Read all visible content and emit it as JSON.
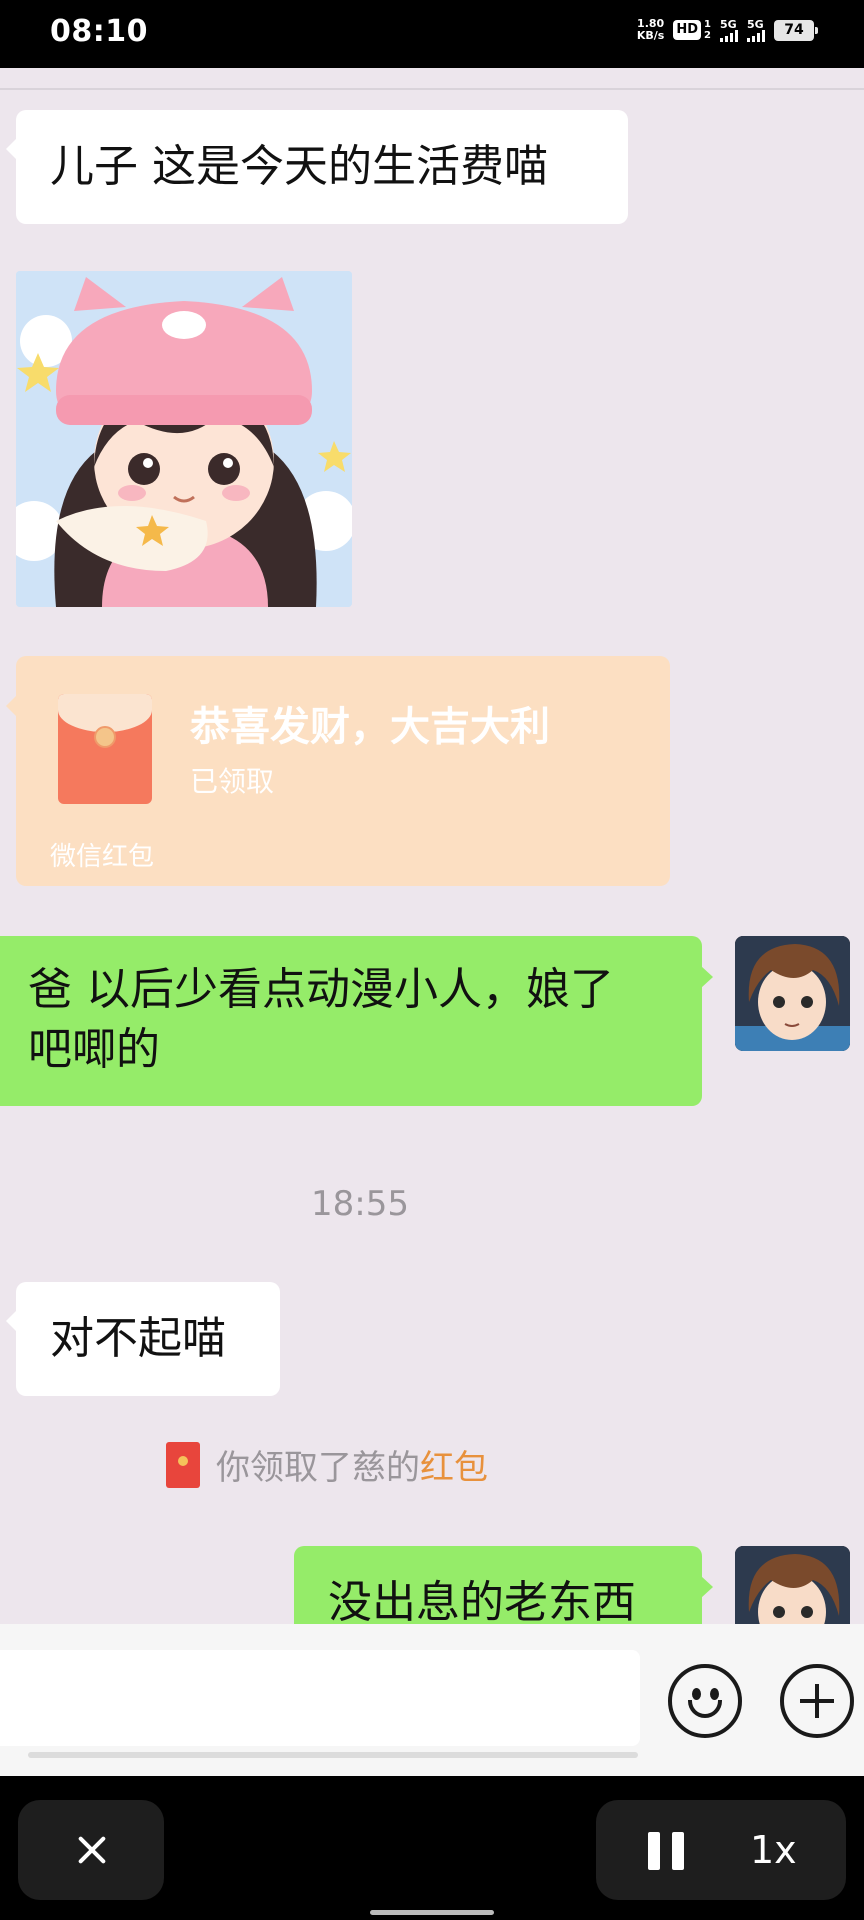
{
  "status_bar": {
    "time": "08:10",
    "net_speed_value": "1.80",
    "net_speed_unit": "KB/s",
    "hd_label": "HD",
    "hd_sub_top": "1",
    "hd_sub_bottom": "2",
    "sim1_label": "5G",
    "sim2_label": "5G",
    "battery": "74"
  },
  "messages": {
    "m1": "儿子 这是今天的生活费喵",
    "m2_line1": "爸 以后少看点动漫小人，娘了",
    "m2_line2": "吧唧的",
    "m3": "对不起喵",
    "m4": "没出息的老东西"
  },
  "red_packet": {
    "title": "恭喜发财，大吉大利",
    "status": "已领取",
    "footer": "微信红包"
  },
  "timestamp": "18:55",
  "system_message": {
    "prefix": "你领取了慈的",
    "highlight": "红包",
    "highlight_color": "#e8913c"
  },
  "player": {
    "speed": "1x"
  },
  "colors": {
    "chat_bg": "#ede6ed",
    "self_bubble": "#95ec69",
    "other_bubble": "#ffffff",
    "red_packet_bg": "#fcdfc2"
  }
}
